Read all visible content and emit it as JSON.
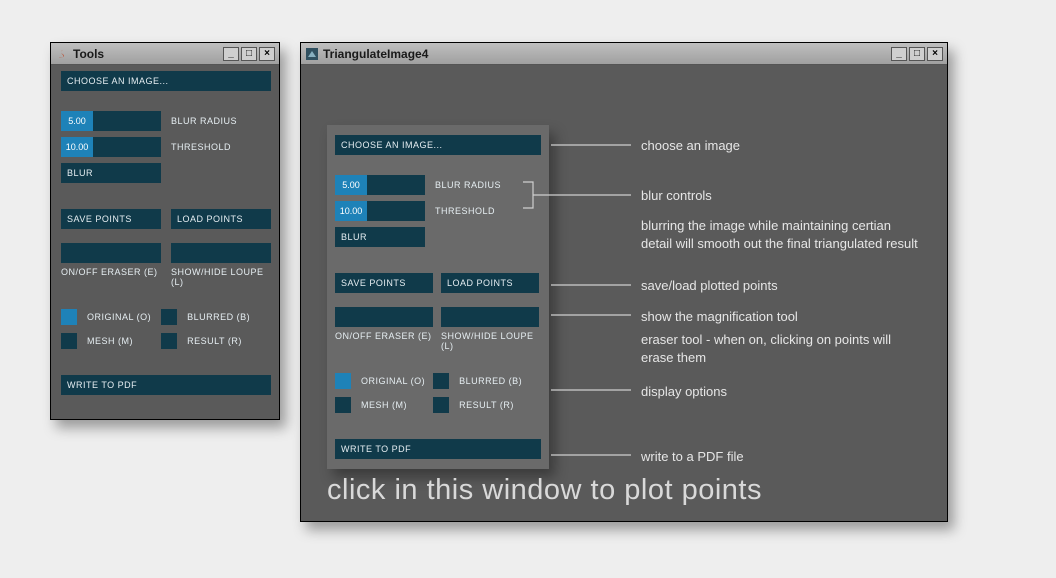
{
  "tools_window": {
    "title": "Tools",
    "choose_image": "CHOOSE AN IMAGE...",
    "blur_radius_value": "5.00",
    "blur_radius_label": "BLUR RADIUS",
    "threshold_value": "10.00",
    "threshold_label": "THRESHOLD",
    "blur_button": "BLUR",
    "save_points": "SAVE POINTS",
    "load_points": "LOAD POINTS",
    "eraser_caption": "ON/OFF ERASER (E)",
    "loupe_caption": "SHOW/HIDE LOUPE (L)",
    "original_label": "ORIGINAL (O)",
    "blurred_label": "BLURRED (B)",
    "mesh_label": "MESH (M)",
    "result_label": "RESULT (R)",
    "write_pdf": "WRITE TO PDF"
  },
  "main_window": {
    "title": "TriangulateImage4",
    "caption": "click in this window to plot points"
  },
  "annotations": {
    "choose_image": "choose an image",
    "blur_controls": "blur controls",
    "blur_detail": "blurring the image while maintaining certian detail will smooth out the final triangulated result",
    "save_load": "save/load plotted points",
    "magnification": "show the magnification tool",
    "eraser": "eraser tool - when on, clicking on points will erase them",
    "display": "display options",
    "write_pdf": "write to a PDF file"
  }
}
